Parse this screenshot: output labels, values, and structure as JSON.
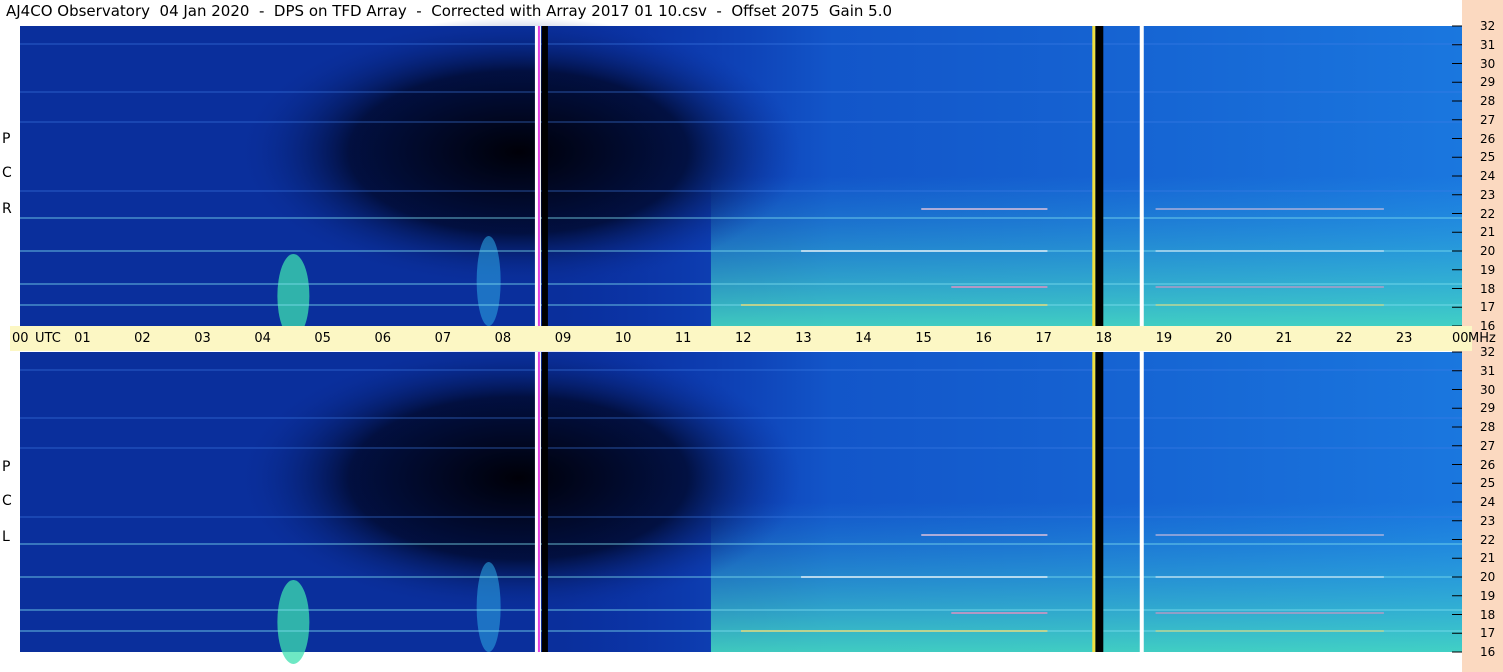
{
  "title": "AJ4CO Observatory  04 Jan 2020  -  DPS on TFD Array  -  Corrected with Array 2017 01 10.csv  -  Offset 2075  Gain 5.0",
  "colors": {
    "background_deep": "#0a2f9c",
    "background_dark": "#000010",
    "emission": "#48e0c0",
    "time_axis_bg": "#fcf7c4",
    "right_axis_bg": "#fbd9c0"
  },
  "chart_data": [
    {
      "type": "heatmap",
      "panel": "top",
      "ylabel": "R C P",
      "y_axis_unit": "",
      "ylim": [
        16,
        32
      ],
      "y_ticks": [
        "32",
        "31",
        "30",
        "29",
        "28",
        "27",
        "26",
        "25",
        "24",
        "23",
        "22",
        "21",
        "20",
        "19",
        "18",
        "17",
        "16"
      ],
      "x_range_utc_hours": [
        0,
        24
      ],
      "gaps_utc_hours": [
        8.67,
        17.93,
        18.67
      ]
    },
    {
      "type": "heatmap",
      "panel": "bottom",
      "ylabel": "L C P",
      "y_axis_unit": "",
      "ylim": [
        16,
        32
      ],
      "y_ticks": [
        "32",
        "31",
        "30",
        "29",
        "28",
        "27",
        "26",
        "25",
        "24",
        "23",
        "22",
        "21",
        "20",
        "19",
        "18",
        "17",
        "16"
      ],
      "x_range_utc_hours": [
        0,
        24
      ],
      "gaps_utc_hours": [
        8.67,
        17.93,
        18.67
      ]
    }
  ],
  "time_axis": {
    "labels": [
      "00",
      "UTC",
      "01",
      "02",
      "03",
      "04",
      "05",
      "06",
      "07",
      "08",
      "09",
      "10",
      "11",
      "12",
      "13",
      "14",
      "15",
      "16",
      "17",
      "18",
      "19",
      "20",
      "21",
      "22",
      "23",
      "00",
      "MHz"
    ]
  }
}
